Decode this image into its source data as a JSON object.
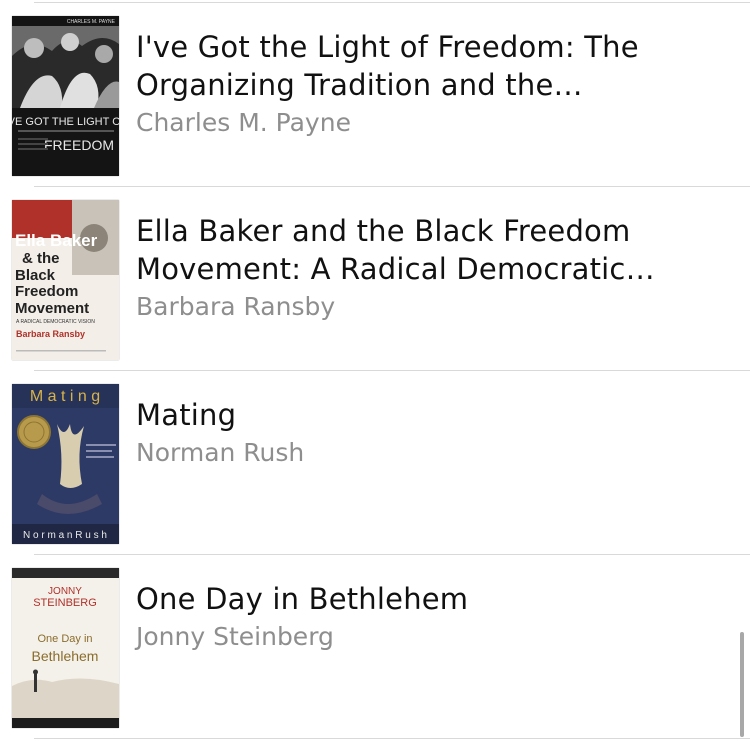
{
  "books": [
    {
      "title": "I've Got the Light of Freedom: The Organizing Tradition and the Mississippi…",
      "author": "Charles M. Payne",
      "cover": {
        "top_text": "CHARLES M. PAYNE",
        "title_line1": "I'VE GOT THE LIGHT OF",
        "title_line2": "FREEDOM"
      }
    },
    {
      "title": "Ella Baker and the Black Freedom Movement: A Radical Democratic Vision",
      "author": "Barbara Ransby",
      "cover": {
        "line1": "Ella Baker",
        "line2": "& the",
        "line3": "Black",
        "line4": "Freedom",
        "line5": "Movement",
        "subtitle": "A RADICAL DEMOCRATIC VISION",
        "author": "Barbara Ransby"
      }
    },
    {
      "title": "Mating",
      "author": "Norman Rush",
      "cover": {
        "title": "M a t i n g",
        "author": "N o r m a n   R u s h"
      }
    },
    {
      "title": "One Day in Bethlehem",
      "author": "Jonny Steinberg",
      "cover": {
        "author_line1": "JONNY",
        "author_line2": "STEINBERG",
        "title_line1": "One Day in",
        "title_line2": "Bethlehem"
      }
    }
  ],
  "colors": {
    "title": "#111111",
    "author": "#8e8e8e",
    "divider": "#d9d9d9",
    "scrollbar": "#a8a8a8"
  }
}
